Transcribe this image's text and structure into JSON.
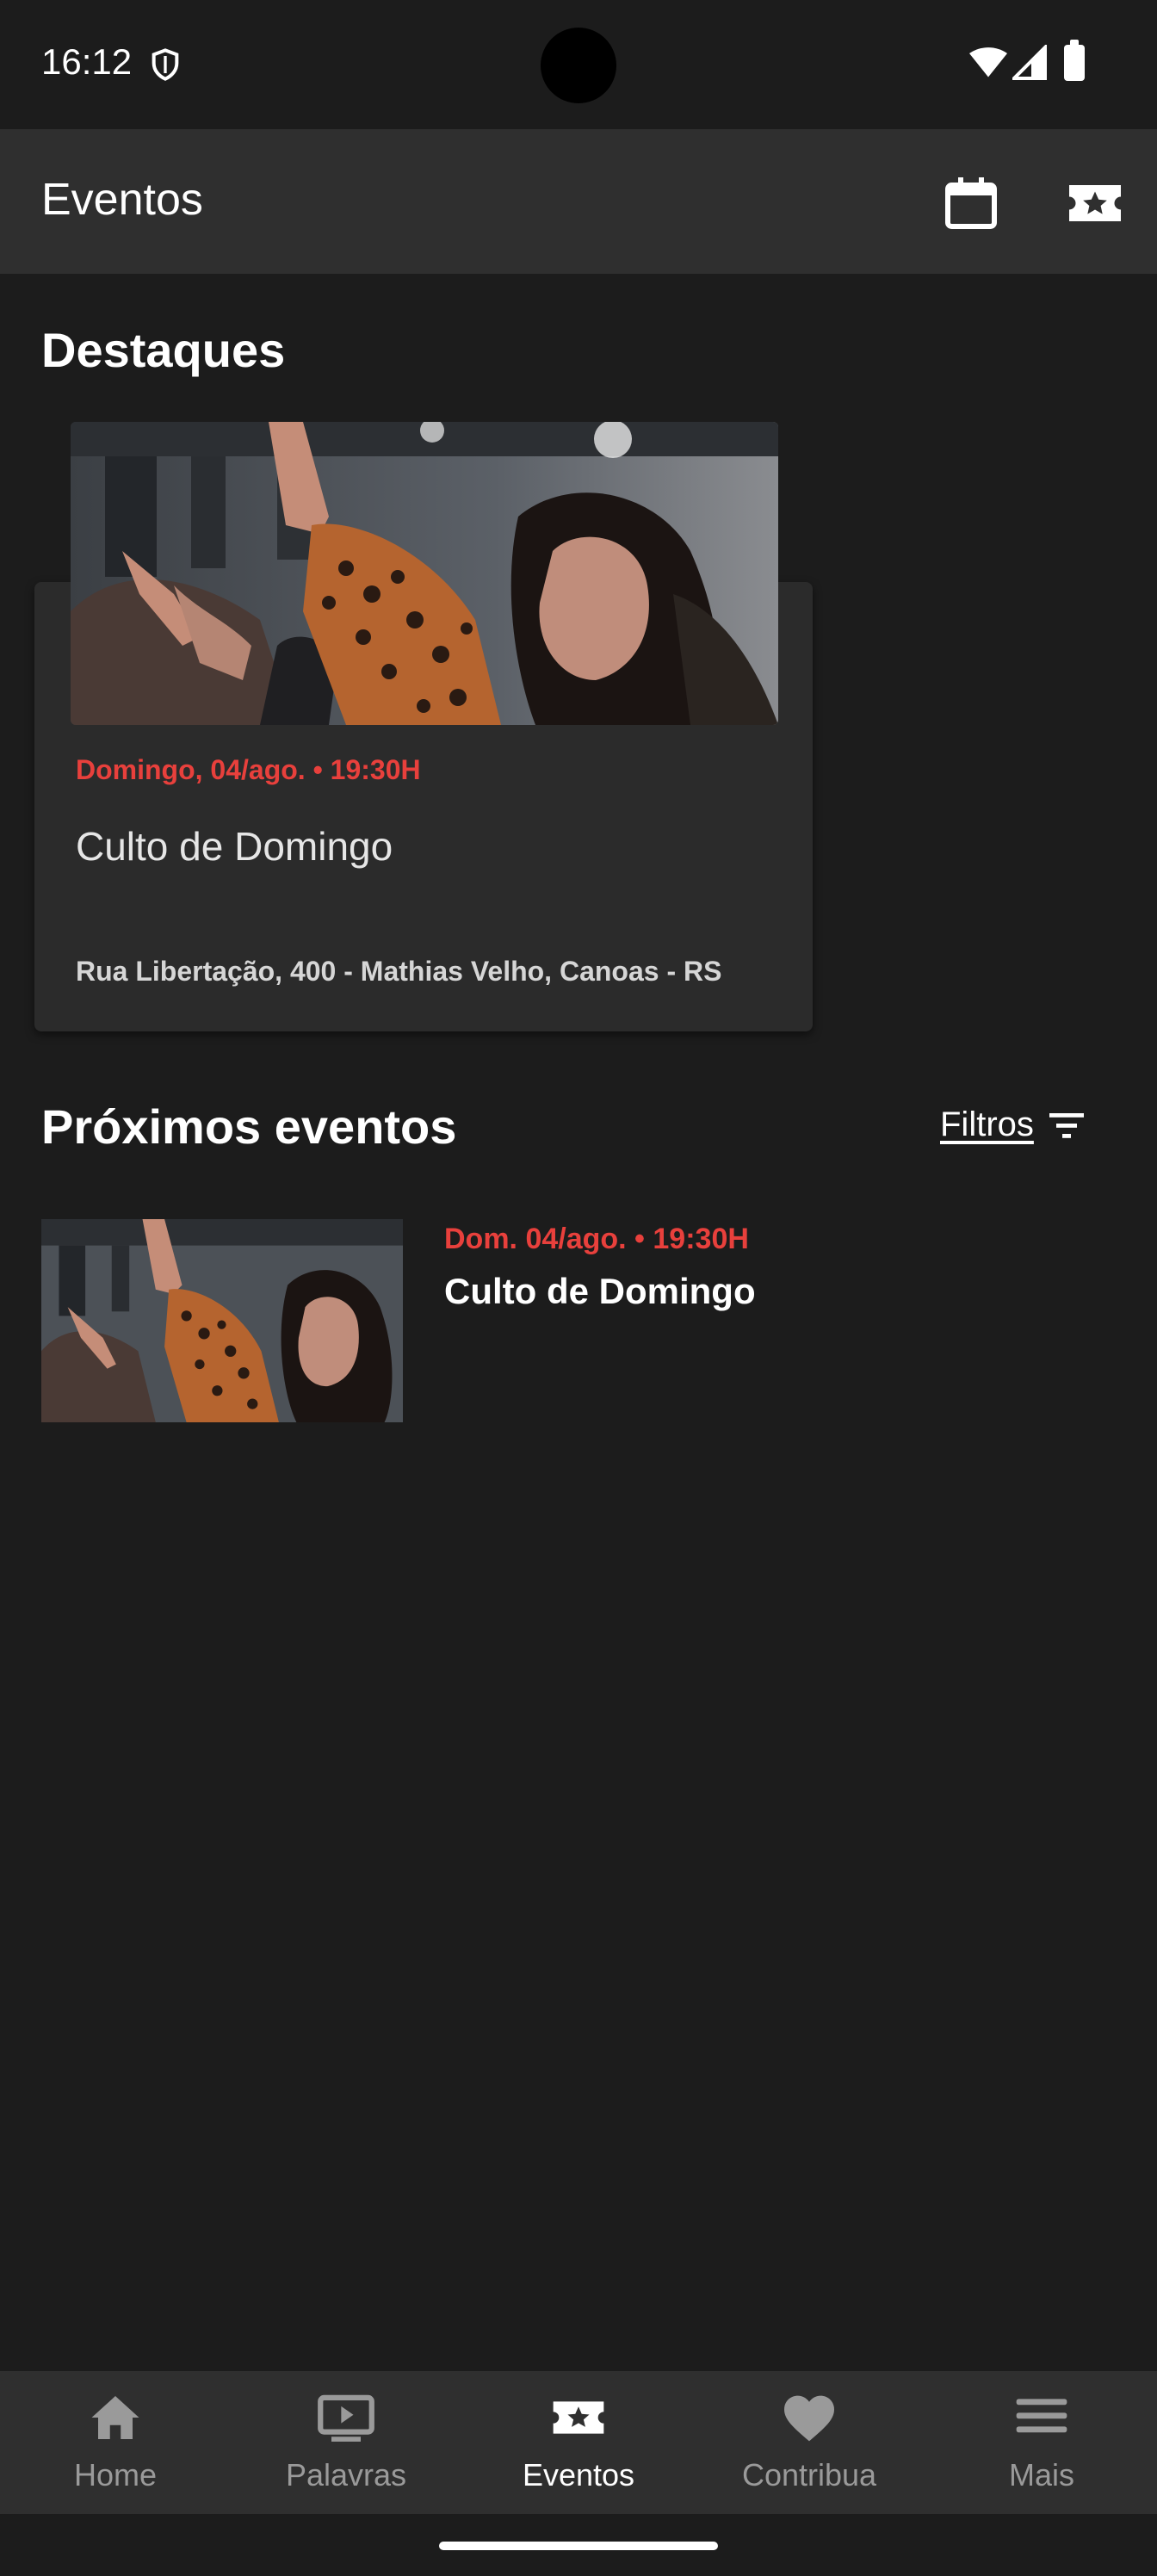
{
  "status_bar": {
    "time": "16:12",
    "icons": [
      "shield-icon",
      "wifi-icon",
      "signal-icon",
      "battery-icon"
    ]
  },
  "app_bar": {
    "title": "Eventos",
    "actions": [
      "calendar-icon",
      "ticket-star-icon"
    ]
  },
  "highlights": {
    "title": "Destaques",
    "card": {
      "date": "Domingo, 04/ago. • 19:30H",
      "name": "Culto de Domingo",
      "address": "Rua Libertação, 400 - Mathias Velho, Canoas - RS"
    }
  },
  "upcoming": {
    "title": "Próximos eventos",
    "filters_label": "Filtros",
    "events": [
      {
        "date": "Dom. 04/ago. • 19:30H",
        "name": "Culto de Domingo"
      }
    ]
  },
  "bottom_nav": {
    "items": [
      {
        "label": "Home",
        "icon": "home-icon"
      },
      {
        "label": "Palavras",
        "icon": "play-screen-icon"
      },
      {
        "label": "Eventos",
        "icon": "ticket-star-icon",
        "active": true
      },
      {
        "label": "Contribua",
        "icon": "heart-icon"
      },
      {
        "label": "Mais",
        "icon": "menu-icon"
      }
    ]
  },
  "colors": {
    "background": "#1c1c1c",
    "bar": "#2f2f2f",
    "card": "#2b2b2b",
    "accent": "#e8403c"
  }
}
